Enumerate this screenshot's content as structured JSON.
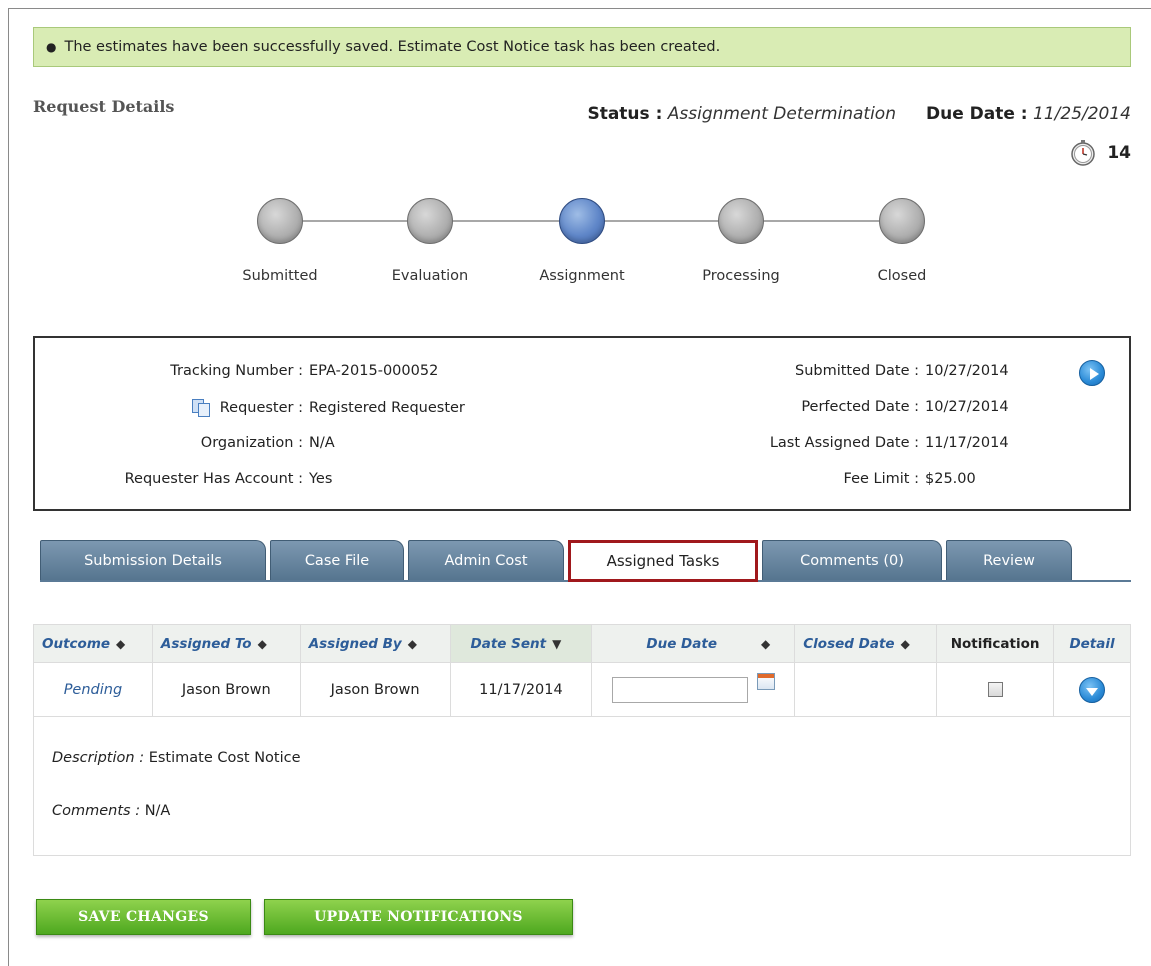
{
  "banner": {
    "message": "The estimates have been successfully saved. Estimate Cost Notice task has been created."
  },
  "section_title": "Request Details",
  "status": {
    "label": "Status :",
    "value": "Assignment Determination"
  },
  "due_date": {
    "label": "Due Date :",
    "value": "11/25/2014"
  },
  "timer": {
    "icon": "stopwatch-icon",
    "days": "14"
  },
  "steps": [
    {
      "label": "Submitted",
      "active": false
    },
    {
      "label": "Evaluation",
      "active": false
    },
    {
      "label": "Assignment",
      "active": true
    },
    {
      "label": "Processing",
      "active": false
    },
    {
      "label": "Closed",
      "active": false
    }
  ],
  "info": {
    "tracking_number": {
      "label": "Tracking Number :",
      "value": "EPA-2015-000052"
    },
    "requester": {
      "label": "Requester :",
      "value": "Registered Requester"
    },
    "organization": {
      "label": "Organization :",
      "value": "N/A"
    },
    "has_account": {
      "label": "Requester Has Account :",
      "value": "Yes"
    },
    "submitted_date": {
      "label": "Submitted Date :",
      "value": "10/27/2014"
    },
    "perfected_date": {
      "label": "Perfected Date :",
      "value": "10/27/2014"
    },
    "last_assigned_date": {
      "label": "Last Assigned Date :",
      "value": "11/17/2014"
    },
    "fee_limit": {
      "label": "Fee Limit :",
      "value": "$25.00"
    }
  },
  "tabs": [
    {
      "label": "Submission Details"
    },
    {
      "label": "Case File"
    },
    {
      "label": "Admin Cost"
    },
    {
      "label": "Assigned Tasks"
    },
    {
      "label": "Comments (0)"
    },
    {
      "label": "Review"
    }
  ],
  "table": {
    "headers": {
      "outcome": "Outcome",
      "assigned_to": "Assigned To",
      "assigned_by": "Assigned By",
      "date_sent": "Date Sent",
      "due_date": "Due Date",
      "closed_date": "Closed Date",
      "notification": "Notification",
      "detail": "Detail"
    },
    "row": {
      "outcome": "Pending",
      "assigned_to": "Jason Brown",
      "assigned_by": "Jason Brown",
      "date_sent": "11/17/2014",
      "due_date": "",
      "closed_date": "",
      "notification_checked": false
    }
  },
  "detail": {
    "description_label": "Description :",
    "description_value": "Estimate Cost Notice",
    "comments_label": "Comments :",
    "comments_value": "N/A"
  },
  "buttons": {
    "save": "SAVE CHANGES",
    "update": "UPDATE NOTIFICATIONS"
  },
  "colors": {
    "banner_bg": "#d9ecb4",
    "tab_blue": "#56758f",
    "active_tab_border": "#a0181c",
    "button_green": "#4ea81f",
    "link_blue": "#2d5d99",
    "active_step": "#5f86c8"
  }
}
